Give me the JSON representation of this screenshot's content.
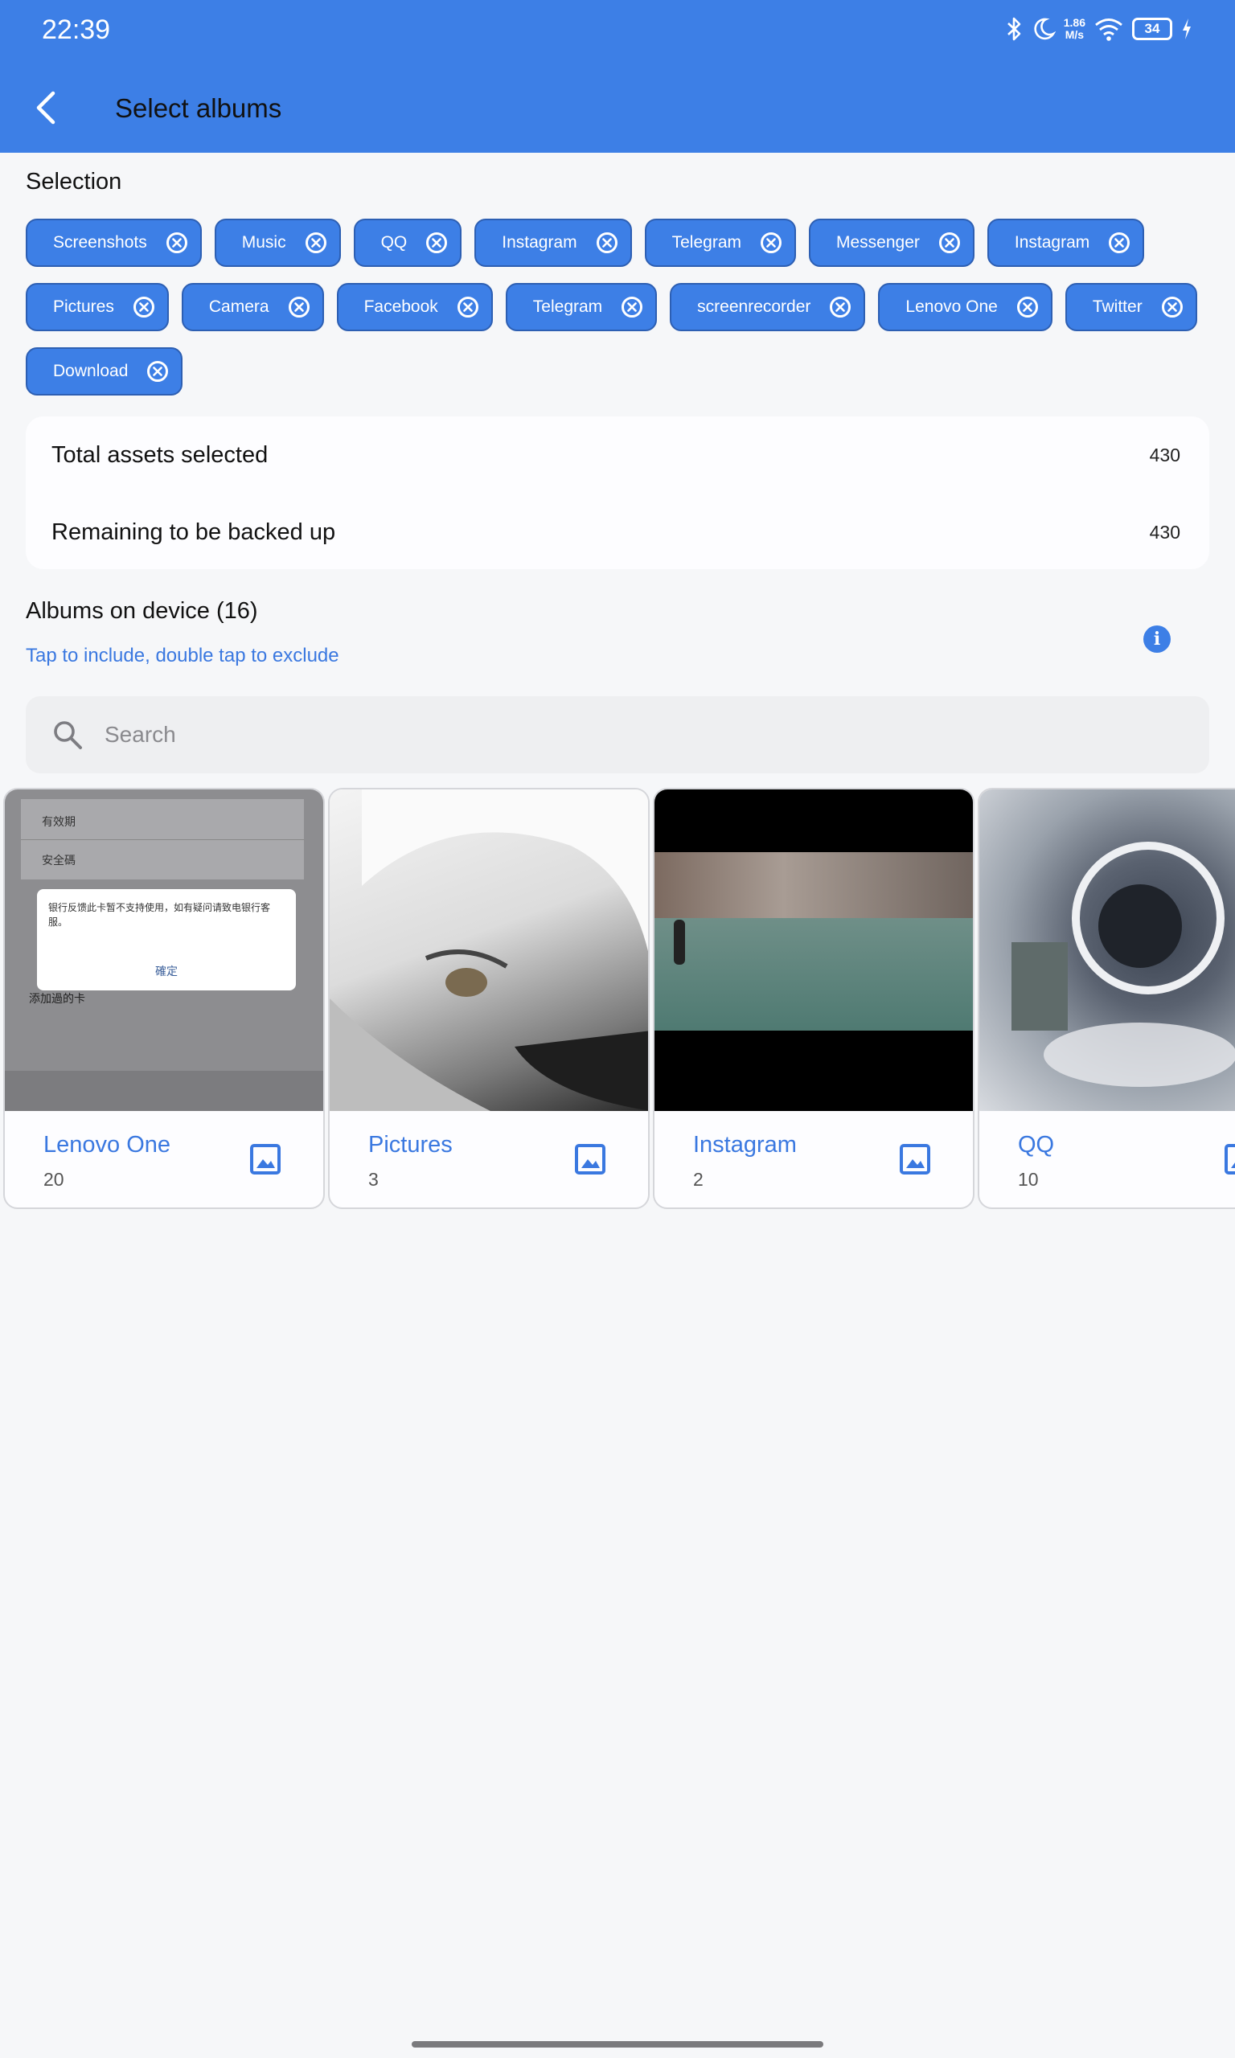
{
  "status_bar": {
    "time": "22:39",
    "net_speed_value": "1.86",
    "net_speed_unit": "M/s",
    "battery": "34"
  },
  "header": {
    "title": "Select albums"
  },
  "selection": {
    "title": "Selection",
    "rows": [
      [
        "Screenshots",
        "Music",
        "QQ",
        "Instagram",
        "Telegram",
        "Messenger",
        "Instagram"
      ],
      [
        "Pictures",
        "Camera",
        "Facebook",
        "Telegram",
        "screenrecorder",
        "Lenovo One",
        "Twitter"
      ],
      [
        "Download"
      ]
    ]
  },
  "stats": {
    "total_label": "Total assets selected",
    "total_value": "430",
    "remaining_label": "Remaining to be backed up",
    "remaining_value": "430"
  },
  "device_albums": {
    "title": "Albums on device (16)",
    "hint": "Tap to include, double tap to exclude",
    "search_placeholder": "Search",
    "cards": [
      {
        "name": "Lenovo One",
        "count": "20",
        "thumb": {
          "field_1": "有效期",
          "field_2": "安全碼",
          "dialog_text": "银行反馈此卡暂不支持使用，如有疑问请致电银行客服。",
          "dialog_button": "確定",
          "add_card": "添加過的卡"
        }
      },
      {
        "name": "Pictures",
        "count": "3"
      },
      {
        "name": "Instagram",
        "count": "2"
      },
      {
        "name": "QQ",
        "count": "10"
      }
    ]
  },
  "colors": {
    "accent": "#3d7fe6",
    "link": "#3a78e0",
    "background": "#f6f7f9"
  }
}
